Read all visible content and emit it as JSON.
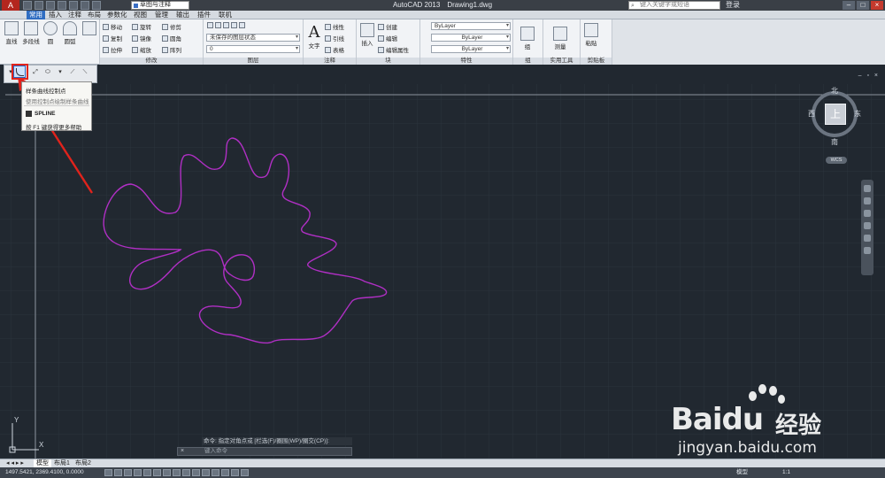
{
  "titlebar": {
    "app_button": "A",
    "workspace": "草图与注释",
    "app_name": "AutoCAD 2013",
    "file_name": "Drawing1.dwg",
    "search_placeholder": "键入关键字或短语",
    "login": "登录",
    "minimize": "–",
    "maximize": "□",
    "close": "×"
  },
  "tabs": [
    "常用",
    "插入",
    "注释",
    "布局",
    "参数化",
    "视图",
    "管理",
    "输出",
    "插件",
    "联机"
  ],
  "ribbon": {
    "draw": {
      "line": "直线",
      "polyline": "多段线",
      "circle": "圆",
      "arc": "圆弧"
    },
    "modify": {
      "title": "修改",
      "move": "移动",
      "rotate": "旋转",
      "trim": "修剪",
      "copy": "复制",
      "mirror": "镜像",
      "fillet": "圆角",
      "stretch": "拉伸",
      "scale": "缩放",
      "array": "阵列"
    },
    "layers": {
      "title": "图层",
      "state": "未保存的图层状态",
      "current": "0"
    },
    "annotation": {
      "title": "注释",
      "text": "文字",
      "linear": "线性",
      "leader": "引线",
      "table": "表格"
    },
    "block": {
      "title": "块",
      "insert": "插入",
      "create": "创建",
      "edit": "编辑",
      "edit_attributes": "编辑属性"
    },
    "properties": {
      "title": "特性",
      "color": "ByLayer",
      "lineweight": "ByLayer",
      "linetype": "ByLayer"
    },
    "groups": {
      "title": "组",
      "group": "组"
    },
    "utilities": {
      "title": "实用工具",
      "measure": "测量"
    },
    "clipboard": {
      "title": "剪贴板",
      "paste": "粘贴"
    }
  },
  "tooltip": {
    "line1": "样条曲线控制点",
    "line2": "使用控制点绘制样条曲线",
    "command": "SPLINE",
    "help": "按 F1 键获得更多帮助"
  },
  "viewport": {
    "window_controls": "– ▫ ×"
  },
  "viewcube": {
    "north": "北",
    "south": "南",
    "east": "东",
    "west": "西",
    "top": "上",
    "wcs": "WCS"
  },
  "ucs": {
    "x": "X",
    "y": "Y"
  },
  "command_line": {
    "history": "命令: 指定对角点或 [栏选(F)/圈围(WP)/圈交(CP)]:",
    "placeholder": "键入命令",
    "close_icon": "×"
  },
  "layout_tabs": [
    "模型",
    "布局1",
    "布局2"
  ],
  "status": {
    "coords": "1497.5421, 2369.4100, 0.0000",
    "model": "模型",
    "scale": "1:1"
  },
  "watermark": {
    "brand": "Bai",
    "brand2": "du",
    "cn": "经验",
    "url": "jingyan.baidu.com"
  },
  "colors": {
    "canvas": "#212830",
    "spline": "#b02fc4",
    "annotation_arrow": "#e0231c",
    "ribbon_active_tab": "#2f6dc2"
  }
}
